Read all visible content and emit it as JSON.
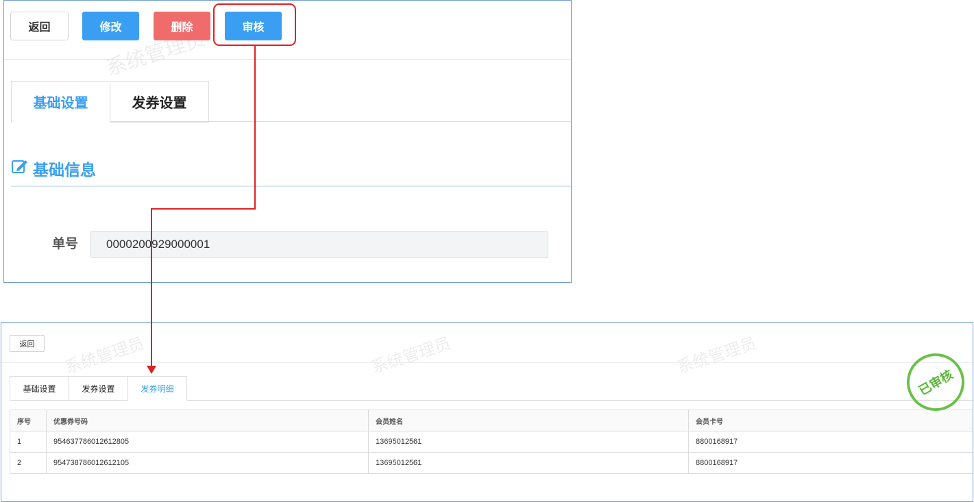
{
  "top_panel": {
    "watermark": "系统管理员",
    "toolbar": {
      "back": "返回",
      "edit": "修改",
      "delete": "删除",
      "audit": "审核"
    },
    "tabs": [
      "基础设置",
      "发券设置"
    ],
    "section_title": "基础信息",
    "order_label": "单号",
    "order_value": "0000200929000001"
  },
  "bottom_panel": {
    "watermark": "系统管理员",
    "back": "返回",
    "tabs": [
      "基础设置",
      "发券设置",
      "发券明细"
    ],
    "stamp": "已审核",
    "table": {
      "headers": [
        "序号",
        "优惠券号码",
        "会员姓名",
        "会员卡号"
      ],
      "rows": [
        [
          "1",
          "954637786012612805",
          "13695012561",
          "8800168917"
        ],
        [
          "2",
          "954738786012612105",
          "13695012561",
          "8800168917"
        ]
      ]
    }
  },
  "colors": {
    "primary": "#3a9ff2",
    "danger": "#f06c6c",
    "annotation": "#e02020",
    "stamp": "#5cb83a"
  }
}
